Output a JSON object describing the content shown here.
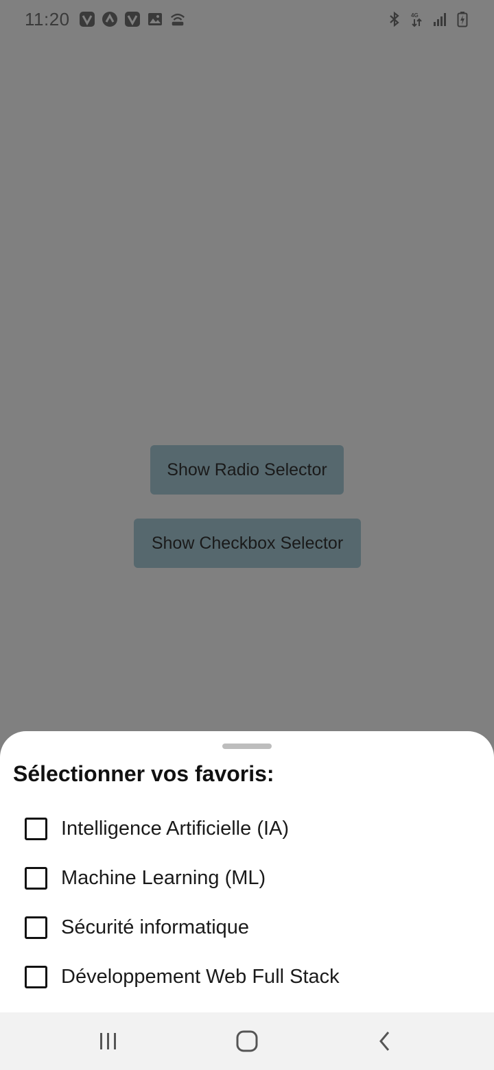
{
  "status_bar": {
    "time": "11:20",
    "left_icons": [
      "v-badge-icon",
      "caret-badge-icon",
      "v-badge-icon",
      "image-icon",
      "hotspot-icon"
    ],
    "right_icons": [
      "bluetooth-icon",
      "data-transfer-icon",
      "signal-icon",
      "battery-charging-icon"
    ]
  },
  "buttons": {
    "radio_label": "Show Radio Selector",
    "checkbox_label": "Show Checkbox Selector"
  },
  "sheet": {
    "title": "Sélectionner vos favoris:",
    "options": [
      {
        "label": "Intelligence Artificielle (IA)",
        "checked": false
      },
      {
        "label": "Machine Learning (ML)",
        "checked": false
      },
      {
        "label": "Sécurité informatique",
        "checked": false
      },
      {
        "label": "Développement Web Full Stack",
        "checked": false
      }
    ]
  },
  "nav_bar": {
    "icons": [
      "recent-apps-icon",
      "home-icon",
      "back-icon"
    ]
  },
  "colors": {
    "scrim": "#808080",
    "button": "#56686e",
    "sheet": "#ffffff",
    "nav_bar": "#f2f2f2"
  }
}
